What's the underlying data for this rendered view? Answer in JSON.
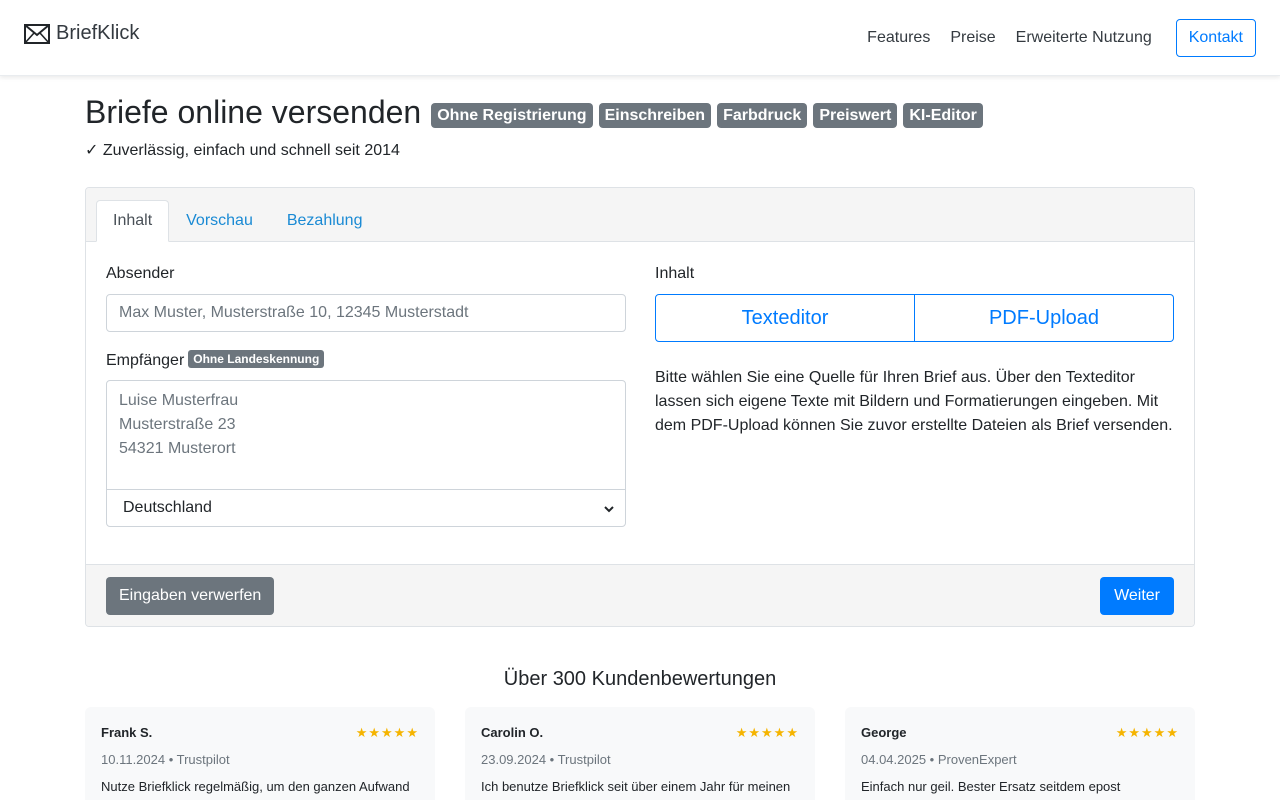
{
  "brand": {
    "name": "BriefKlick"
  },
  "nav": {
    "items": [
      "Features",
      "Preise",
      "Erweiterte Nutzung"
    ],
    "contact": "Kontakt"
  },
  "hero": {
    "title": "Briefe online versenden",
    "badges": [
      "Ohne Registrierung",
      "Einschreiben",
      "Farbdruck",
      "Preiswert",
      "KI-Editor"
    ],
    "subtitle": "✓ Zuverlässig, einfach und schnell seit 2014"
  },
  "tabs": [
    "Inhalt",
    "Vorschau",
    "Bezahlung"
  ],
  "form": {
    "sender_label": "Absender",
    "sender_placeholder": "Max Muster, Musterstraße 10, 12345 Musterstadt",
    "recipient_label": "Empfänger",
    "recipient_badge": "Ohne Landeskennung",
    "recipient_placeholder": "Luise Musterfrau\nMusterstraße 23\n54321 Musterort",
    "country": "Deutschland",
    "content_label": "Inhalt",
    "texteditor_button": "Texteditor",
    "pdf_button": "PDF-Upload",
    "info": "Bitte wählen Sie eine Quelle für Ihren Brief aus. Über den Texteditor lassen sich eigene Texte mit Bildern und Formatierungen eingeben. Mit dem PDF-Upload können Sie zuvor erstellte Dateien als Brief versenden."
  },
  "footer": {
    "discard": "Eingaben verwerfen",
    "next": "Weiter"
  },
  "reviews": {
    "title": "Über 300 Kundenbewertungen",
    "items": [
      {
        "name": "Frank S.",
        "stars": "★★★★★",
        "meta": "10.11.2024 • Trustpilot",
        "text": "Nutze Briefklick regelmäßig, um den ganzen Aufwand"
      },
      {
        "name": "Carolin O.",
        "stars": "★★★★★",
        "meta": "23.09.2024 • Trustpilot",
        "text": "Ich benutze Briefklick seit über einem Jahr für meinen"
      },
      {
        "name": "George",
        "stars": "★★★★★",
        "meta": "04.04.2025 • ProvenExpert",
        "text": "Einfach nur geil. Bester Ersatz seitdem epost"
      }
    ]
  },
  "colors": {
    "primary": "#007bff",
    "secondary": "#6c757d",
    "link": "#1a8ad4",
    "star": "#f5b400"
  }
}
